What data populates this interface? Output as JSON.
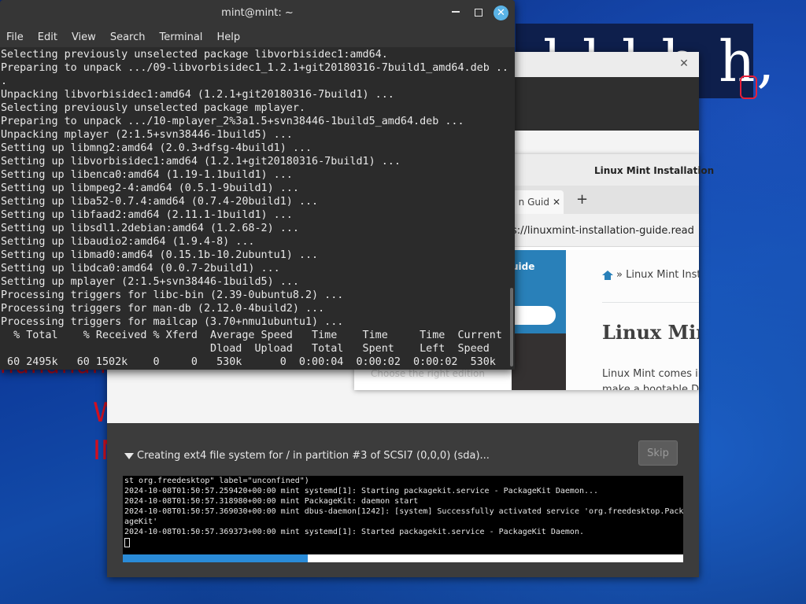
{
  "desktop": {
    "bg_text_1": "nananana",
    "bg_text_2": "W",
    "bg_text_3": "IN",
    "banner_glyphs": "l l l h h,"
  },
  "installer": {
    "status_text": "Creating ext4 file system for / in partition #3 of SCSI7 (0,0,0) (sda)...",
    "skip_label": "Skip",
    "progress_percent": 33,
    "log_lines": [
      "st org.freedesktop\" label=\"unconfined\")",
      "2024-10-08T01:50:57.259420+00:00 mint systemd[1]: Starting packagekit.service - PackageKit Daemon...",
      "2024-10-08T01:50:57.318980+00:00 mint PackageKit: daemon start",
      "2024-10-08T01:50:57.369030+00:00 mint dbus-daemon[1242]: [system] Successfully activated service 'org.freedesktop.Pack",
      "ageKit'",
      "2024-10-08T01:50:57.369373+00:00 mint systemd[1]: Started packagekit.service - PackageKit Daemon."
    ]
  },
  "browser": {
    "window_title": "Linux Mint Installation",
    "tab_label": "n Guid",
    "url": "s://linuxmint-installation-guide.read",
    "sidebar_title": "uide",
    "sidebar_link": "Choose the right edition",
    "breadcrumb": "» Linux Mint Inst",
    "heading": "Linux Mint",
    "paragraph_1": "Linux Mint comes in",
    "paragraph_2": "make a bootable DV"
  },
  "terminal": {
    "title": "mint@mint: ~",
    "menu": [
      "File",
      "Edit",
      "View",
      "Search",
      "Terminal",
      "Help"
    ],
    "lines": [
      "Selecting previously unselected package libvorbisidec1:amd64.",
      "Preparing to unpack .../09-libvorbisidec1_1.2.1+git20180316-7build1_amd64.deb ..",
      ".",
      "Unpacking libvorbisidec1:amd64 (1.2.1+git20180316-7build1) ...",
      "Selecting previously unselected package mplayer.",
      "Preparing to unpack .../10-mplayer_2%3a1.5+svn38446-1build5_amd64.deb ...",
      "Unpacking mplayer (2:1.5+svn38446-1build5) ...",
      "Setting up libmng2:amd64 (2.0.3+dfsg-4build1) ...",
      "Setting up libvorbisidec1:amd64 (1.2.1+git20180316-7build1) ...",
      "Setting up libenca0:amd64 (1.19-1.1build1) ...",
      "Setting up libmpeg2-4:amd64 (0.5.1-9build1) ...",
      "Setting up liba52-0.7.4:amd64 (0.7.4-20build1) ...",
      "Setting up libfaad2:amd64 (2.11.1-1build1) ...",
      "Setting up libsdl1.2debian:amd64 (1.2.68-2) ...",
      "Setting up libaudio2:amd64 (1.9.4-8) ...",
      "Setting up libmad0:amd64 (0.15.1b-10.2ubuntu1) ...",
      "Setting up libdca0:amd64 (0.0.7-2build1) ...",
      "Setting up mplayer (2:1.5+svn38446-1build5) ...",
      "Processing triggers for libc-bin (2.39-0ubuntu8.2) ...",
      "Processing triggers for man-db (2.12.0-4build2) ...",
      "Processing triggers for mailcap (3.70+nmu1ubuntu1) ...",
      "  % Total    % Received % Xferd  Average Speed   Time    Time     Time  Current",
      "                                 Dload  Upload   Total   Spent    Left  Speed",
      " 60 2495k   60 1502k    0     0   530k      0  0:00:04  0:00:02  0:00:02  530k"
    ]
  }
}
